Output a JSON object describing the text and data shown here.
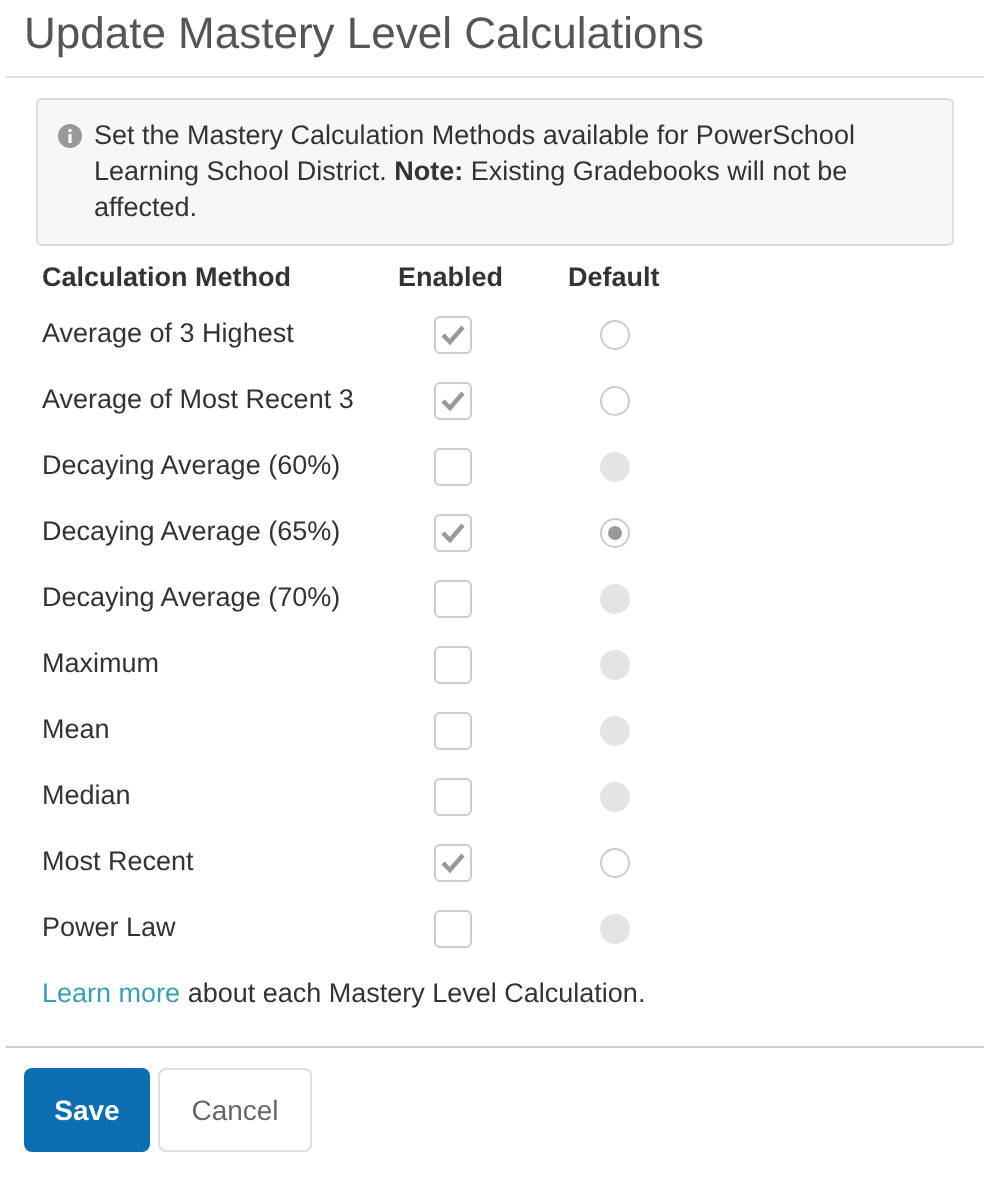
{
  "title": "Update Mastery Level Calculations",
  "notice": "Set the Mastery Calculation Methods available for PowerSchool Learning School District. **Note:** Existing Gradebooks will not be affected.",
  "columns": [
    "Calculation Method",
    "Enabled",
    "Default"
  ],
  "rows": [
    {
      "name": "Average of 3 Highest",
      "enabled": true,
      "default": {
        "selected": false,
        "disabled": false
      }
    },
    {
      "name": "Average of Most Recent 3",
      "enabled": true,
      "default": {
        "selected": false,
        "disabled": false
      }
    },
    {
      "name": "Decaying Average (60%)",
      "enabled": false,
      "default": {
        "selected": false,
        "disabled": true
      }
    },
    {
      "name": "Decaying Average (65%)",
      "enabled": true,
      "default": {
        "selected": true,
        "disabled": false
      }
    },
    {
      "name": "Decaying Average (70%)",
      "enabled": false,
      "default": {
        "selected": false,
        "disabled": true
      }
    },
    {
      "name": "Maximum",
      "enabled": false,
      "default": {
        "selected": false,
        "disabled": true
      }
    },
    {
      "name": "Mean",
      "enabled": false,
      "default": {
        "selected": false,
        "disabled": true
      }
    },
    {
      "name": "Median",
      "enabled": false,
      "default": {
        "selected": false,
        "disabled": true
      }
    },
    {
      "name": "Most Recent",
      "enabled": true,
      "default": {
        "selected": false,
        "disabled": false
      }
    },
    {
      "name": "Power Law",
      "enabled": false,
      "default": {
        "selected": false,
        "disabled": true
      }
    }
  ],
  "footer": {
    "link": "Learn more",
    "text": "about each Mastery Level Calculation."
  },
  "buttons": {
    "save": "Save",
    "cancel": "Cancel"
  }
}
